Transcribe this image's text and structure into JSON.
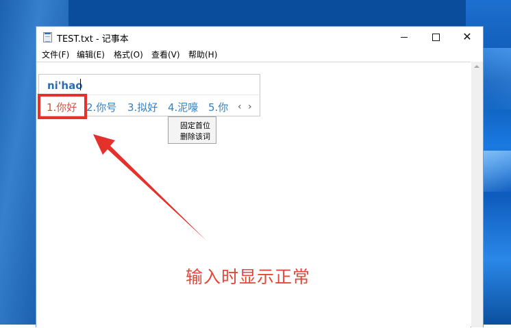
{
  "window": {
    "title": "TEST.txt - 记事本",
    "controls": {
      "minimize": "minimize",
      "maximize": "maximize",
      "close": "✕"
    }
  },
  "menu": [
    {
      "label": "文件(F)"
    },
    {
      "label": "编辑(E)"
    },
    {
      "label": "格式(O)"
    },
    {
      "label": "查看(V)"
    },
    {
      "label": "帮助(H)"
    }
  ],
  "ime": {
    "composition": "ni'hao",
    "candidates": [
      {
        "label": "1.你好"
      },
      {
        "label": "2.你号"
      },
      {
        "label": "3.拟好"
      },
      {
        "label": "4.泥嚎"
      },
      {
        "label": "5.你"
      }
    ],
    "prev_page": "‹",
    "next_page": "›"
  },
  "context_menu": [
    {
      "label": "固定首位"
    },
    {
      "label": "删除该词"
    }
  ],
  "annotation": {
    "text": "输入时显示正常",
    "color": "#e4312b"
  },
  "colors": {
    "desktop": "#0a4d9c",
    "candidate_text": "#2f7fc4",
    "selected_candidate": "#d4503c"
  }
}
